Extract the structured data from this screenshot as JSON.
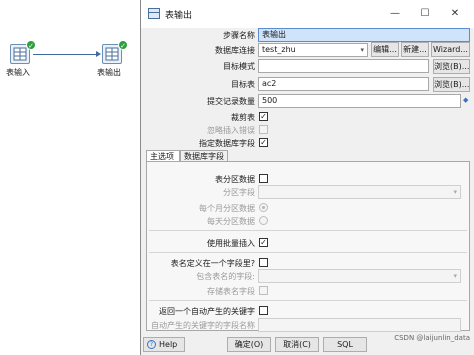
{
  "canvas": {
    "steps": [
      {
        "name": "表输入"
      },
      {
        "name": "表输出"
      }
    ]
  },
  "dialog": {
    "title": "表输出",
    "step_name_label": "步骤名称",
    "step_name_value": "表输出",
    "connection_label": "数据库连接",
    "connection_value": "test_zhu",
    "edit_button": "编辑...",
    "new_button": "新建...",
    "wizard_button": "Wizard...",
    "schema_label": "目标模式",
    "schema_value": "",
    "browse_button": "浏览(B)...",
    "table_label": "目标表",
    "table_value": "ac2",
    "commit_label": "提交记录数量",
    "commit_value": "500",
    "truncate_label": "裁剪表",
    "truncate_checked": "✓",
    "ignore_errors_label": "忽略插入错误",
    "specify_fields_label": "指定数据库字段",
    "specify_fields_checked": "✓",
    "tabs": [
      "主选项",
      "数据库字段"
    ],
    "partition_label": "表分区数据",
    "partition_field_label": "分区字段",
    "partition_monthly_label": "每个月分区数据",
    "partition_daily_label": "每天分区数据",
    "batch_insert_label": "使用批量插入",
    "batch_insert_checked": "✓",
    "table_name_in_field_label": "表名定义在一个字段里?",
    "table_name_field_label": "包含表名的字段:",
    "store_table_name_label": "存储表名字段",
    "return_key_label": "返回一个自动产生的关键字",
    "key_field_name_label": "自动产生的关键字的字段名称",
    "help_button": "Help",
    "ok_button": "确定(O)",
    "cancel_button": "取消(C)",
    "sql_button": "SQL"
  },
  "watermark": "CSDN @laijunlin_data"
}
